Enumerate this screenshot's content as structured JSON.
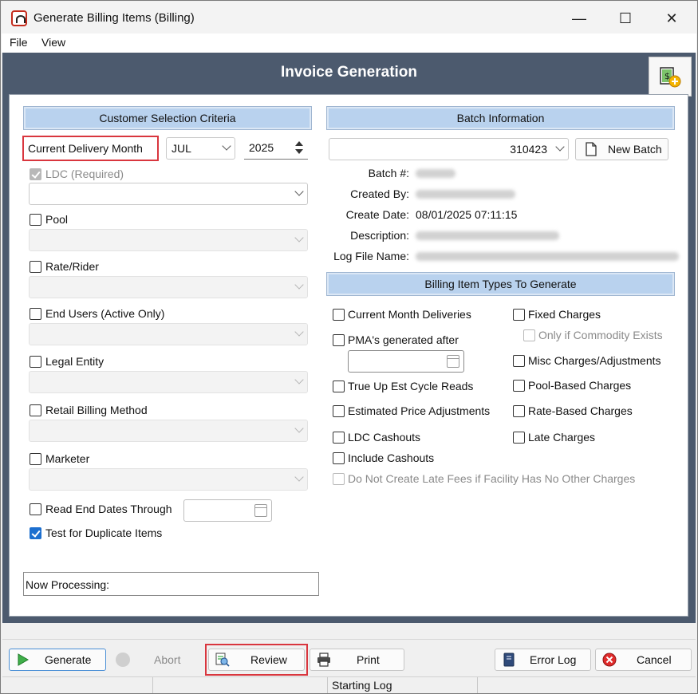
{
  "window": {
    "title": "Generate Billing Items (Billing)",
    "controls": {
      "minimize": "—",
      "maximize": "☐",
      "close": "✕"
    }
  },
  "menu": {
    "file": "File",
    "view": "View"
  },
  "header": {
    "title": "Invoice Generation",
    "button_icon": "new-invoice-icon"
  },
  "customer_selection": {
    "heading": "Customer Selection Criteria",
    "current_delivery_month_label": "Current Delivery Month",
    "month_value": "JUL",
    "year_value": "2025",
    "ldc_label": "LDC (Required)",
    "ldc_value": "",
    "pool_label": "Pool",
    "rate_rider_label": "Rate/Rider",
    "end_users_label": "End Users (Active Only)",
    "legal_entity_label": "Legal Entity",
    "retail_billing_method_label": "Retail Billing Method",
    "marketer_label": "Marketer",
    "read_end_dates_label": "Read End Dates Through",
    "read_end_dates_value": "",
    "test_duplicates_label": "Test for Duplicate Items",
    "now_processing": "Now Processing:"
  },
  "batch": {
    "heading": "Batch Information",
    "batch_select_value": "310423",
    "new_batch_label": "New Batch",
    "batch_no_label": "Batch #:",
    "created_by_label": "Created By:",
    "create_date_label": "Create Date:",
    "create_date_value": "08/01/2025 07:11:15",
    "description_label": "Description:",
    "log_file_label": "Log File Name:"
  },
  "billing_types": {
    "heading": "Billing Item Types To Generate",
    "current_month_deliveries": "Current Month Deliveries",
    "pmas_generated_after": "PMA's generated after",
    "pmas_date_value": "",
    "true_up": "True Up Est Cycle Reads",
    "estimated_price_adj": "Estimated Price Adjustments",
    "ldc_cashouts": "LDC Cashouts",
    "include_cashouts": "Include Cashouts",
    "no_late_fees": "Do Not Create Late Fees if Facility Has No Other Charges",
    "fixed_charges": "Fixed Charges",
    "only_if_commodity": "Only if Commodity Exists",
    "misc_charges": "Misc Charges/Adjustments",
    "pool_based": "Pool-Based Charges",
    "rate_based": "Rate-Based Charges",
    "late_charges": "Late Charges"
  },
  "buttons": {
    "generate": "Generate",
    "abort": "Abort",
    "review": "Review",
    "print": "Print",
    "error_log": "Error Log",
    "cancel": "Cancel"
  },
  "status_bar": {
    "log": "Starting Log"
  },
  "colors": {
    "header_bg": "#4c5a6e",
    "section_head_bg": "#b9d2ee",
    "highlight_border": "#d9363e",
    "checkbox_checked": "#1c6fcf"
  }
}
